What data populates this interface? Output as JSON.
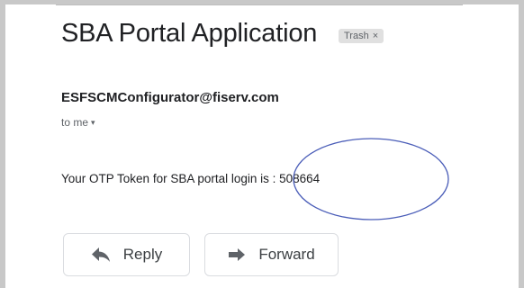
{
  "email": {
    "subject": "SBA Portal Application",
    "label": "Trash",
    "label_close": "×",
    "sender": "ESFSCMConfigurator@fiserv.com",
    "recipient": "to me",
    "recipient_caret": "▾",
    "body": "Your OTP Token for SBA portal login is : 508664"
  },
  "actions": {
    "reply_label": "Reply",
    "forward_label": "Forward"
  },
  "icons": {
    "reply": "reply-arrow-icon",
    "forward": "forward-arrow-icon"
  },
  "colors": {
    "annotation_circle": "#4a5db8",
    "chip_bg": "#e0e0e0"
  }
}
